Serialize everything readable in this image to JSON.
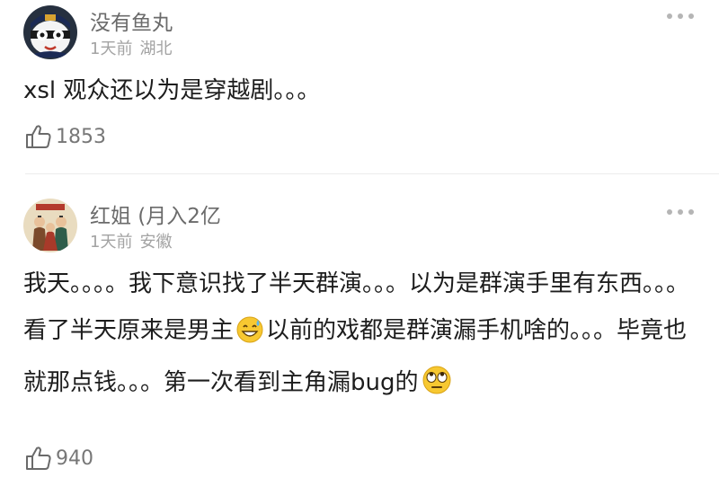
{
  "comments": [
    {
      "username": "没有鱼丸",
      "time": "1天前",
      "location": "湖北",
      "text": "xsl 观众还以为是穿越剧。。。",
      "likes": "1853",
      "more_icon": "more-dots-icon",
      "like_icon": "thumbs-up-icon"
    },
    {
      "username": "红姐 (月入2亿",
      "time": "1天前",
      "location": "安徽",
      "text_part1": "我天。。。。我下意识找了半天群演。。。以为是群演手里有东西。。。看了半天原来是男主",
      "emoji1": "grinning-sweat-emoji",
      "text_part2": "以前的戏都是群演漏手机啥的。。。毕竟也就那点钱。。。第一次看到主角漏bug的",
      "emoji2": "eye-roll-emoji",
      "likes": "940",
      "more_icon": "more-dots-icon",
      "like_icon": "thumbs-up-icon"
    }
  ]
}
